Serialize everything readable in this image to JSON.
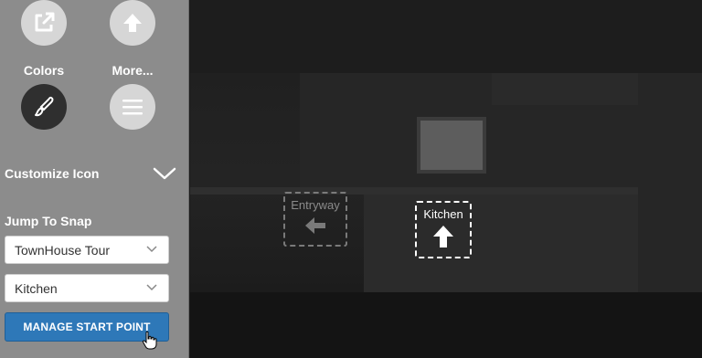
{
  "sidebar": {
    "top_icons": {
      "share_icon": "external-link-icon",
      "upload_icon": "up-arrow-icon"
    },
    "colors_label": "Colors",
    "more_label": "More...",
    "colors_icon": "paintbrush-icon",
    "more_icon": "menu-icon",
    "customize_label": "Customize Icon",
    "jump_label": "Jump To Snap",
    "tour_select": {
      "value": "TownHouse Tour"
    },
    "snap_select": {
      "value": "Kitchen"
    },
    "manage_button": "MANAGE START POINT"
  },
  "panorama": {
    "hotspots": [
      {
        "label": "Entryway",
        "arrow": "left"
      },
      {
        "label": "Kitchen",
        "arrow": "up"
      }
    ]
  },
  "colors": {
    "sidebar_bg": "#8c8c8c",
    "button_blue": "#2e78b8"
  }
}
